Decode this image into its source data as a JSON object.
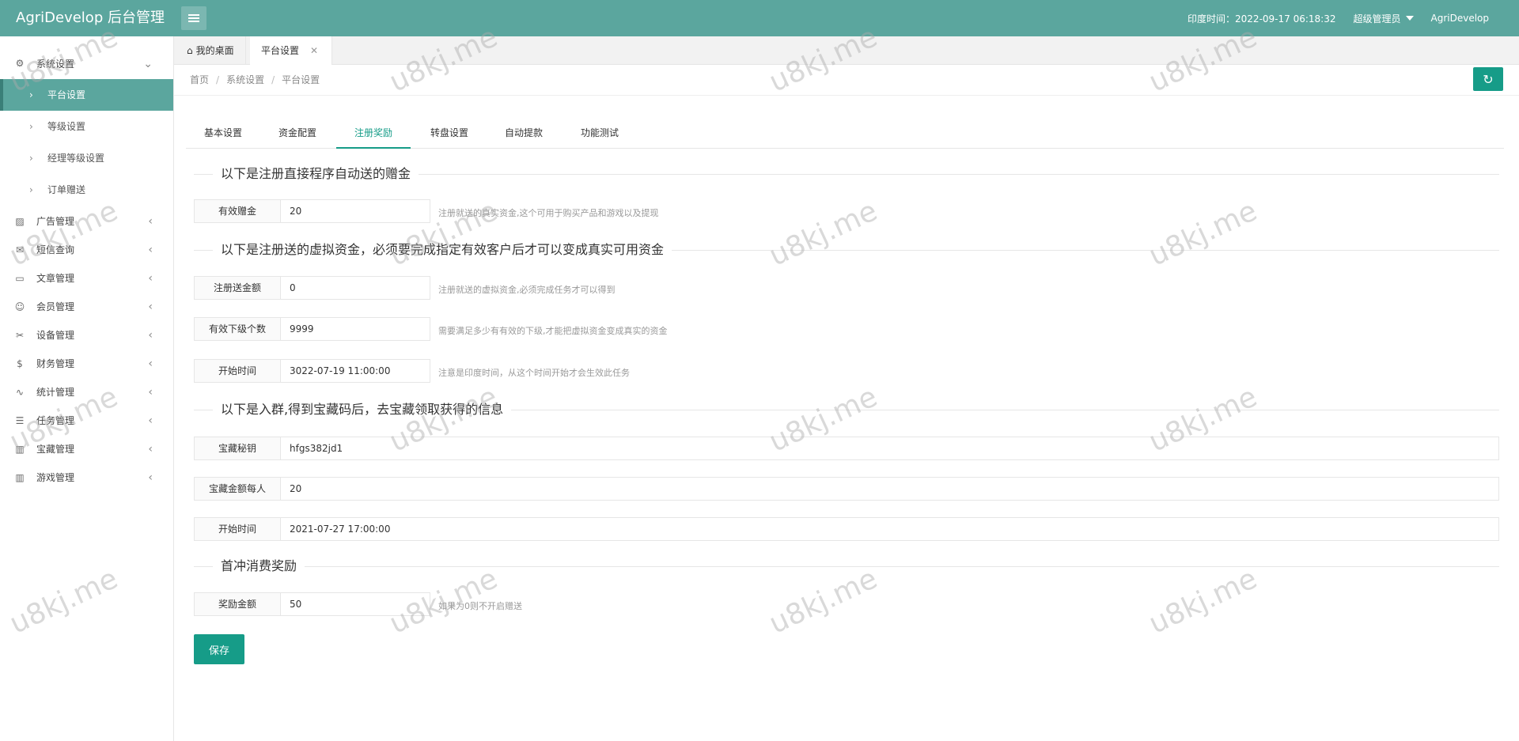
{
  "header": {
    "logo": "AgriDevelop 后台管理",
    "time_label": "印度时间：2022-09-17 06:18:32",
    "role": "超级管理员",
    "user": "AgriDevelop"
  },
  "sidebar": {
    "open_group": "系统设置",
    "sub_items": [
      "平台设置",
      "等级设置",
      "经理等级设置",
      "订单赠送"
    ],
    "groups": [
      "广告管理",
      "短信查询",
      "文章管理",
      "会员管理",
      "设备管理",
      "财务管理",
      "统计管理",
      "任务管理",
      "宝藏管理",
      "游戏管理"
    ]
  },
  "tabs": {
    "home": "我的桌面",
    "active": "平台设置"
  },
  "breadcrumb": [
    "首页",
    "系统设置",
    "平台设置"
  ],
  "settings_tabs": [
    "基本设置",
    "资金配置",
    "注册奖励",
    "转盘设置",
    "自动提款",
    "功能测试"
  ],
  "sections": {
    "s1": "以下是注册直接程序自动送的赠金",
    "s2": "以下是注册送的虚拟资金，必须要完成指定有效客户后才可以变成真实可用资金",
    "s3": "以下是入群,得到宝藏码后，去宝藏领取获得的信息",
    "s4": "首冲消费奖励"
  },
  "fields": {
    "bonus": {
      "label": "有效赠金",
      "value": "20",
      "hint": "注册就送的真实资金,这个可用于购买产品和游戏以及提现"
    },
    "reg_amount": {
      "label": "注册送金额",
      "value": "0",
      "hint": "注册就送的虚拟资金,必须完成任务才可以得到"
    },
    "sub_count": {
      "label": "有效下级个数",
      "value": "9999",
      "hint": "需要满足多少有有效的下级,才能把虚拟资金变成真实的资金"
    },
    "start_time": {
      "label": "开始时间",
      "value": "3022-07-19 11:00:00",
      "hint": "注意是印度时间，从这个时间开始才会生效此任务"
    },
    "treasure_key": {
      "label": "宝藏秘钥",
      "value": "hfgs382jd1"
    },
    "treasure_amount": {
      "label": "宝藏金额每人",
      "value": "20"
    },
    "treasure_time": {
      "label": "开始时间",
      "value": "2021-07-27 17:00:00"
    },
    "reward": {
      "label": "奖励金额",
      "value": "50",
      "hint": "如果为0则不开启赠送"
    }
  },
  "save_label": "保存",
  "watermark": "u8kj.me",
  "colors": {
    "header": "#5ba69e",
    "accent": "#169c88"
  }
}
